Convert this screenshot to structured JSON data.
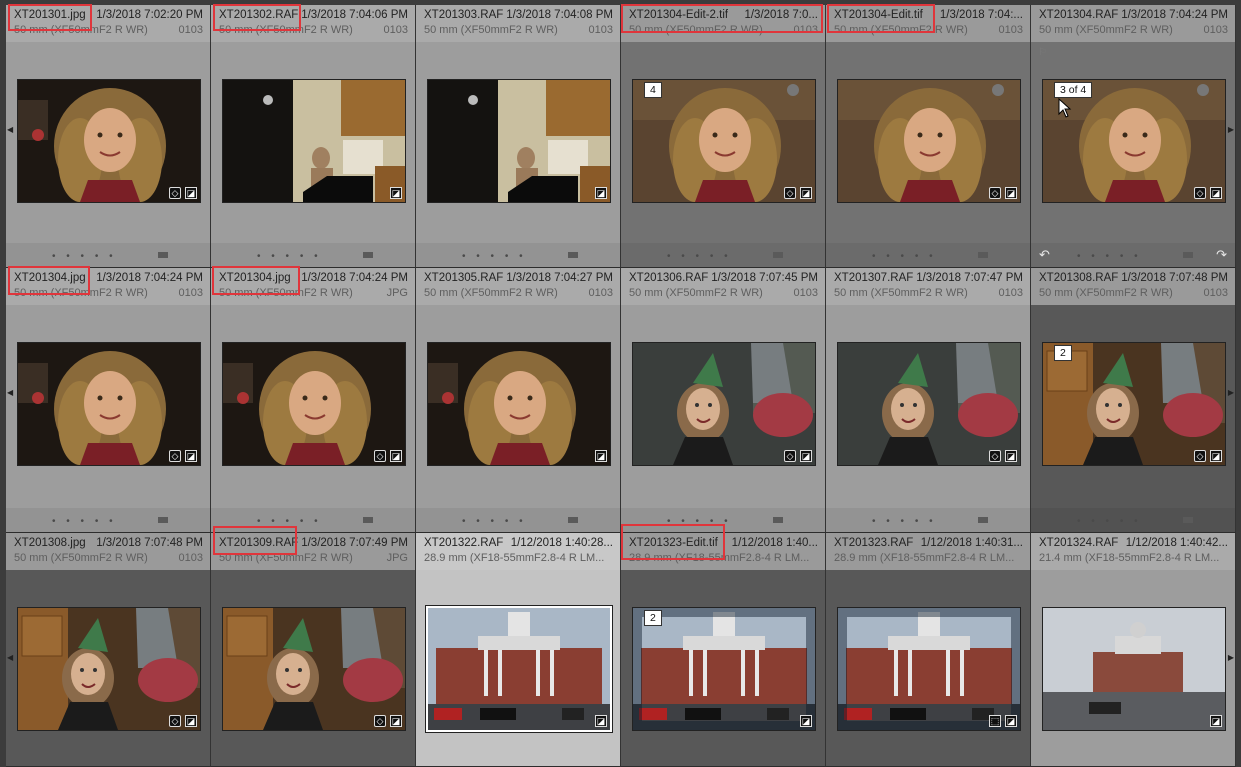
{
  "library_grid": {
    "cells": [
      {
        "filename": "XT201301.jpg",
        "datetime": "1/3/2018 7:02:20 PM",
        "lens": "50 mm (XF50mmF2 R WR)",
        "code": "0103",
        "tone": "light",
        "scene": "girl-dark",
        "stack_badge": "",
        "kw": true,
        "crop": false,
        "sel": false,
        "dots": true
      },
      {
        "filename": "XT201302.RAF",
        "datetime": "1/3/2018 7:04:06 PM",
        "lens": "50 mm (XF50mmF2 R WR)",
        "code": "0103",
        "tone": "light",
        "scene": "kitchen",
        "stack_badge": "",
        "kw": false,
        "crop": false,
        "sel": false,
        "dots": true
      },
      {
        "filename": "XT201303.RAF",
        "datetime": "1/3/2018 7:04:08 PM",
        "lens": "50 mm (XF50mmF2 R WR)",
        "code": "0103",
        "tone": "light",
        "scene": "kitchen",
        "stack_badge": "",
        "kw": false,
        "crop": false,
        "sel": false,
        "dots": true
      },
      {
        "filename": "XT201304-Edit-2.tif",
        "datetime": "1/3/2018 7:0...",
        "lens": "50 mm (XF50mmF2 R WR)",
        "code": "0103",
        "tone": "stack",
        "scene": "girl-warm",
        "stack_badge": "4",
        "kw": true,
        "crop": false,
        "sel": false,
        "dots": true
      },
      {
        "filename": "XT201304-Edit.tif",
        "datetime": "1/3/2018 7:04:...",
        "lens": "50 mm (XF50mmF2 R WR)",
        "code": "0103",
        "tone": "stack",
        "scene": "girl-warm",
        "stack_badge": "",
        "kw": true,
        "crop": false,
        "sel": false,
        "dots": true
      },
      {
        "filename": "XT201304.RAF",
        "datetime": "1/3/2018 7:04:24 PM",
        "lens": "50 mm (XF50mmF2 R WR)",
        "code": "0103",
        "tone": "stack",
        "scene": "girl-warm",
        "stack_badge": "3 of 4",
        "kw": true,
        "crop": false,
        "sel": false,
        "dots": true,
        "rotate": true
      },
      {
        "filename": "XT201304.jpg",
        "datetime": "1/3/2018 7:04:24 PM",
        "lens": "50 mm (XF50mmF2 R WR)",
        "code": "0103",
        "tone": "light",
        "scene": "girl-dark",
        "stack_badge": "",
        "kw": true,
        "crop": false,
        "sel": false,
        "dots": true
      },
      {
        "filename": "XT201304.jpg",
        "datetime": "1/3/2018 7:04:24 PM",
        "lens": "50 mm (XF50mmF2 R WR)",
        "code": "JPG",
        "tone": "light",
        "scene": "girl-dark",
        "stack_badge": "",
        "kw": true,
        "crop": false,
        "sel": false,
        "dots": true
      },
      {
        "filename": "XT201305.RAF",
        "datetime": "1/3/2018 7:04:27 PM",
        "lens": "50 mm (XF50mmF2 R WR)",
        "code": "0103",
        "tone": "light",
        "scene": "girl-dark",
        "stack_badge": "",
        "kw": false,
        "crop": false,
        "sel": false,
        "dots": true
      },
      {
        "filename": "XT201306.RAF",
        "datetime": "1/3/2018 7:07:45 PM",
        "lens": "50 mm (XF50mmF2 R WR)",
        "code": "0103",
        "tone": "light",
        "scene": "party",
        "stack_badge": "",
        "kw": true,
        "crop": false,
        "sel": false,
        "dots": true
      },
      {
        "filename": "XT201307.RAF",
        "datetime": "1/3/2018 7:07:47 PM",
        "lens": "50 mm (XF50mmF2 R WR)",
        "code": "0103",
        "tone": "light",
        "scene": "party",
        "stack_badge": "",
        "kw": true,
        "crop": false,
        "sel": false,
        "dots": true
      },
      {
        "filename": "XT201308.RAF",
        "datetime": "1/3/2018 7:07:48 PM",
        "lens": "50 mm (XF50mmF2 R WR)",
        "code": "0103",
        "tone": "dark",
        "scene": "party-kitchen",
        "stack_badge": "2",
        "kw": true,
        "crop": false,
        "sel": false,
        "dots": true
      },
      {
        "filename": "XT201308.jpg",
        "datetime": "1/3/2018 7:07:48 PM",
        "lens": "50 mm (XF50mmF2 R WR)",
        "code": "0103",
        "tone": "dark",
        "scene": "party-kitchen",
        "stack_badge": "",
        "kw": true,
        "crop": false,
        "sel": false,
        "dots": false
      },
      {
        "filename": "XT201309.RAF",
        "datetime": "1/3/2018 7:07:49 PM",
        "lens": "50 mm (XF50mmF2 R WR)",
        "code": "JPG",
        "tone": "dark",
        "scene": "party-kitchen",
        "stack_badge": "",
        "kw": true,
        "crop": false,
        "sel": false,
        "dots": false
      },
      {
        "filename": "XT201322.RAF",
        "datetime": "1/12/2018 1:40:28...",
        "lens": "28.9 mm (XF18-55mmF2.8-4 R LM...",
        "code": "",
        "tone": "sel",
        "scene": "courthouse",
        "stack_badge": "",
        "kw": false,
        "crop": false,
        "sel": true,
        "dots": false
      },
      {
        "filename": "XT201323-Edit.tif",
        "datetime": "1/12/2018 1:40...",
        "lens": "28.9 mm (XF18-55mmF2.8-4 R LM...",
        "code": "",
        "tone": "dark",
        "scene": "courthouse-vig",
        "stack_badge": "2",
        "kw": false,
        "crop": false,
        "sel": false,
        "dots": false
      },
      {
        "filename": "XT201323.RAF",
        "datetime": "1/12/2018 1:40:31...",
        "lens": "28.9 mm (XF18-55mmF2.8-4 R LM...",
        "code": "",
        "tone": "dark",
        "scene": "courthouse-vig",
        "stack_badge": "",
        "kw": false,
        "crop": true,
        "sel": false,
        "dots": false
      },
      {
        "filename": "XT201324.RAF",
        "datetime": "1/12/2018 1:40:42...",
        "lens": "21.4 mm (XF18-55mmF2.8-4 R LM...",
        "code": "",
        "tone": "light",
        "scene": "courthouse-wide",
        "stack_badge": "",
        "kw": false,
        "crop": false,
        "sel": false,
        "dots": false
      }
    ],
    "highlighted_cells": [
      0,
      1,
      3,
      4,
      6,
      7,
      13,
      15
    ]
  }
}
